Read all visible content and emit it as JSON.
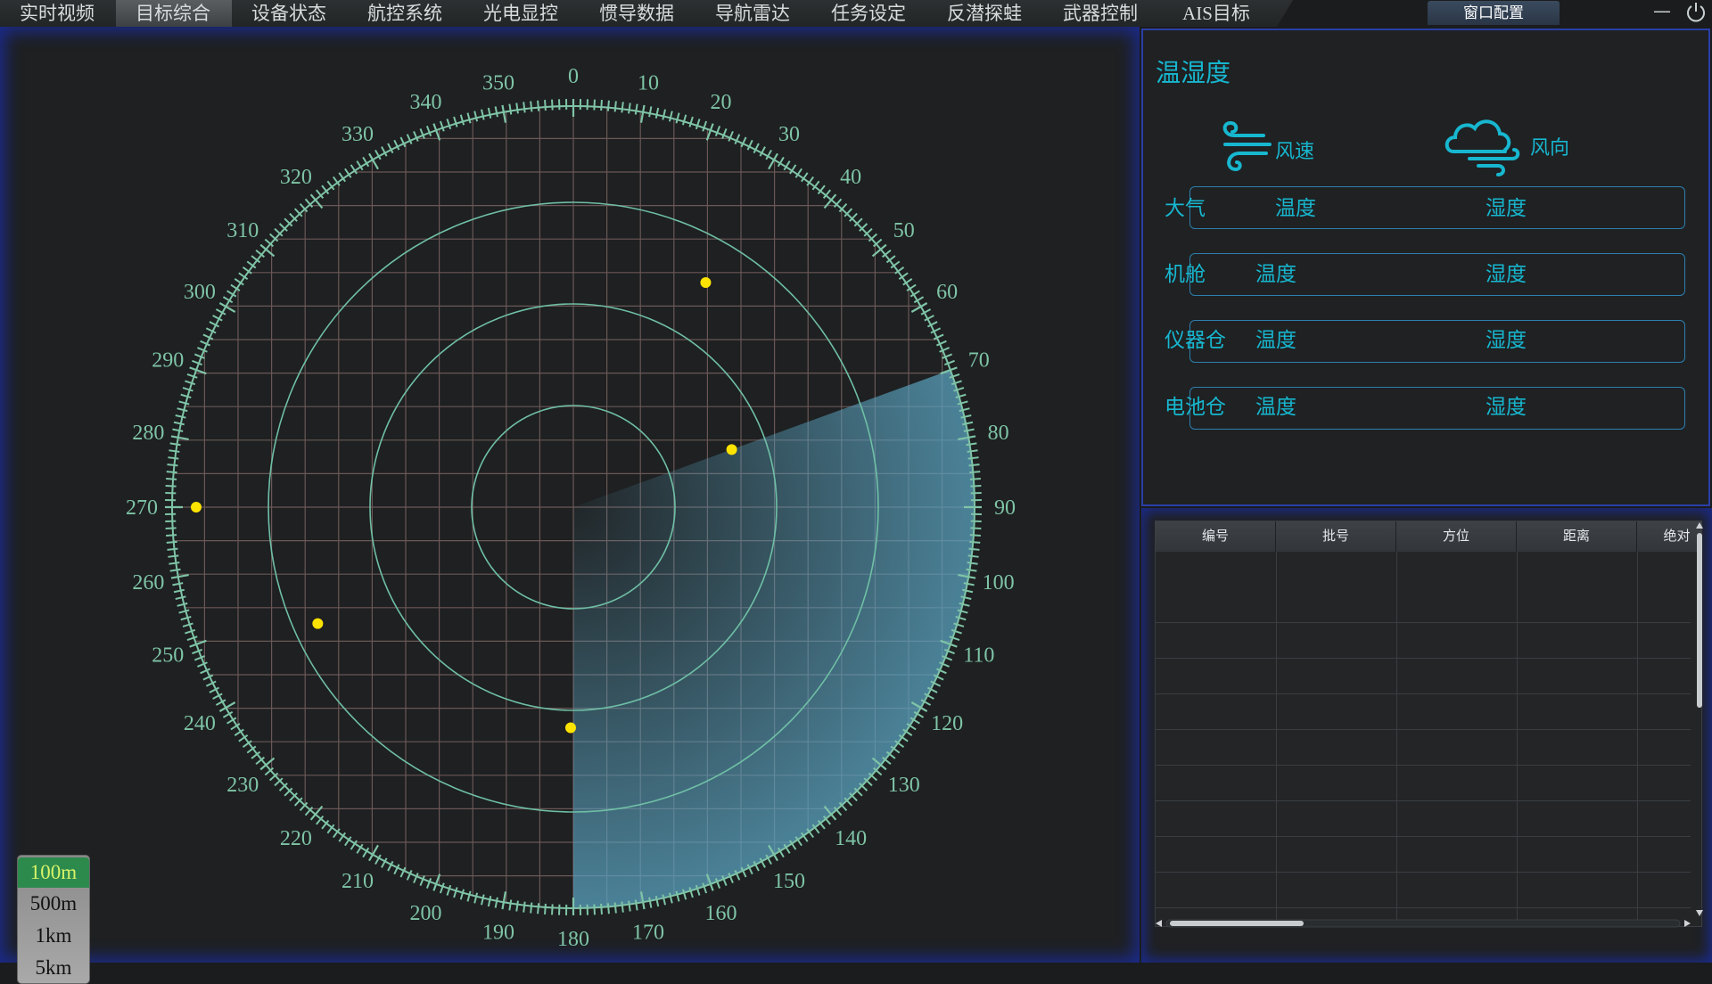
{
  "tabs": [
    {
      "label": "实时视频",
      "active": false
    },
    {
      "label": "目标综合",
      "active": true
    },
    {
      "label": "设备状态",
      "active": false
    },
    {
      "label": "航控系统",
      "active": false
    },
    {
      "label": "光电显控",
      "active": false
    },
    {
      "label": "惯导数据",
      "active": false
    },
    {
      "label": "导航雷达",
      "active": false
    },
    {
      "label": "任务设定",
      "active": false
    },
    {
      "label": "反潜探蛙",
      "active": false
    },
    {
      "label": "武器控制",
      "active": false
    },
    {
      "label": "AIS目标",
      "active": false
    }
  ],
  "window_config_label": "窗口配置",
  "minimize_symbol": "—",
  "radar": {
    "bearing_labels": [
      "0",
      "10",
      "20",
      "30",
      "40",
      "50",
      "60",
      "70",
      "80",
      "90",
      "100",
      "110",
      "120",
      "130",
      "140",
      "150",
      "160",
      "170",
      "180",
      "190",
      "200",
      "210",
      "220",
      "230",
      "240",
      "250",
      "260",
      "270",
      "280",
      "290",
      "300",
      "310",
      "320",
      "330",
      "340",
      "350"
    ],
    "sweep_start_deg": 70,
    "sweep_end_deg": 180,
    "range_rings": 3,
    "targets": [
      {
        "bearing_deg": 30.5,
        "range_frac": 0.65
      },
      {
        "bearing_deg": 70.0,
        "range_frac": 0.42
      },
      {
        "bearing_deg": 270.0,
        "range_frac": 0.94
      },
      {
        "bearing_deg": 245.5,
        "range_frac": 0.7
      },
      {
        "bearing_deg": 180.7,
        "range_frac": 0.55
      }
    ],
    "colors": {
      "scale": "#7fc4a7",
      "grid": "#6b5757",
      "ring": "#6fbfa5",
      "target": "#ffe300",
      "sweep": "#5aa2bf"
    }
  },
  "range_options": [
    {
      "label": "100m",
      "active": true
    },
    {
      "label": "500m",
      "active": false
    },
    {
      "label": "1km",
      "active": false
    },
    {
      "label": "5km",
      "active": false
    }
  ],
  "env": {
    "title": "温湿度",
    "wind_speed_label": "风速",
    "wind_dir_label": "风向",
    "rows": [
      {
        "name": "大气",
        "temp": "温度",
        "hum": "湿度"
      },
      {
        "name": "机舱",
        "temp": "温度",
        "hum": "湿度"
      },
      {
        "name": "仪器仓",
        "temp": "温度",
        "hum": "湿度"
      },
      {
        "name": "电池仓",
        "temp": "温度",
        "hum": "湿度"
      }
    ]
  },
  "table": {
    "headers": [
      "编号",
      "批号",
      "方位",
      "距离",
      "绝对"
    ],
    "row_count": 9
  }
}
